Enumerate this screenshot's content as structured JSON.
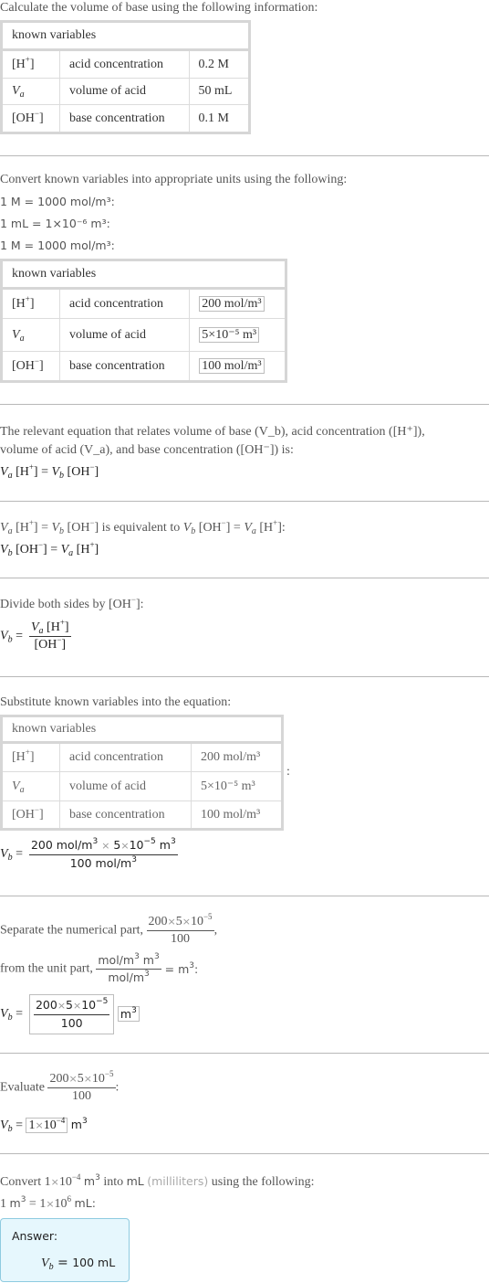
{
  "intro": "Calculate the volume of base using the following information:",
  "table1": {
    "header": "known variables",
    "rows": [
      {
        "symbol": "[H⁺]",
        "name": "acid concentration",
        "value": "0.2 M"
      },
      {
        "symbol": "V_a",
        "name": "volume of acid",
        "value": "50 mL"
      },
      {
        "symbol": "[OH⁻]",
        "name": "base concentration",
        "value": "0.1 M"
      }
    ]
  },
  "convert": {
    "text": "Convert known variables into appropriate units using the following:",
    "rules": [
      "1 M = 1000 mol/m³:",
      "1 mL = 1×10⁻⁶ m³:",
      "1 M = 1000 mol/m³:"
    ]
  },
  "table2": {
    "header": "known variables",
    "rows": [
      {
        "symbol": "[H⁺]",
        "name": "acid concentration",
        "value": "200 mol/m³"
      },
      {
        "symbol": "V_a",
        "name": "volume of acid",
        "value": "5×10⁻⁵ m³"
      },
      {
        "symbol": "[OH⁻]",
        "name": "base concentration",
        "value": "100 mol/m³"
      }
    ]
  },
  "relevant": {
    "line1": "The relevant equation that relates volume of base (V_b), acid concentration ([H⁺]),",
    "line2": "volume of acid (V_a), and base concentration ([OH⁻]) is:",
    "equation": "V_a [H⁺] = V_b [OH⁻]"
  },
  "equivalent": {
    "text": "V_a [H⁺] = V_b [OH⁻] is equivalent to V_b [OH⁻] = V_a [H⁺]:",
    "equation": "V_b [OH⁻] = V_a [H⁺]"
  },
  "divide": {
    "text": "Divide both sides by [OH⁻]:",
    "equation": "V_b = V_a [H⁺] / [OH⁻]"
  },
  "substitute": {
    "text": "Substitute known variables into the equation:",
    "header": "known variables",
    "rows": [
      {
        "symbol": "[H⁺]",
        "name": "acid concentration",
        "value": "200 mol/m³"
      },
      {
        "symbol": "V_a",
        "name": "volume of acid",
        "value": "5×10⁻⁵ m³"
      },
      {
        "symbol": "[OH⁻]",
        "name": "base concentration",
        "value": "100 mol/m³"
      }
    ],
    "equation": "V_b = 200 mol/m³ × 5×10⁻⁵ m³ / 100 mol/m³"
  },
  "separate": {
    "text1": "Separate the numerical part,",
    "text2": "from the unit part,",
    "numeric": "200×5×10⁻⁵ / 100",
    "units": "mol/m³ m³ / mol/m³ = m³",
    "equation": "V_b = (200×5×10⁻⁵ / 100) m³"
  },
  "evaluate": {
    "text": "Evaluate",
    "expr": "200×5×10⁻⁵ / 100",
    "equation": "V_b = 1×10⁻⁴ m³"
  },
  "final_convert": {
    "text": "Convert 1×10⁻⁴ m³ into mL (milliliters) using the following:",
    "rule": "1 m³ = 1×10⁶ mL:"
  },
  "answer": {
    "label": "Answer:",
    "value": "V_b = 100 mL"
  }
}
